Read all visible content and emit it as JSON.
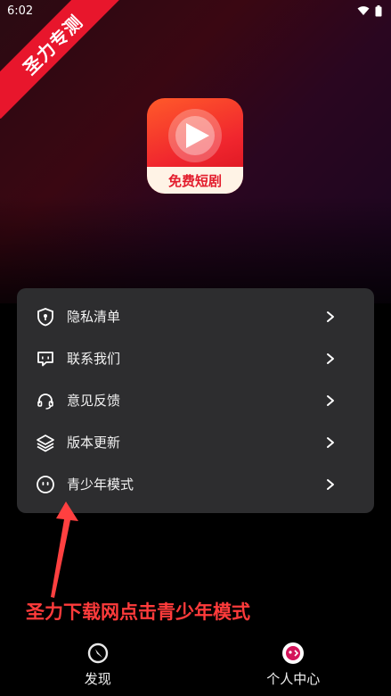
{
  "status_bar": {
    "time": "6:02"
  },
  "ribbon": {
    "text": "圣力专测"
  },
  "app_logo": {
    "banner_text": "免费短剧"
  },
  "menu": {
    "items": [
      {
        "label": "隐私清单",
        "icon": "shield-icon"
      },
      {
        "label": "联系我们",
        "icon": "message-icon"
      },
      {
        "label": "意见反馈",
        "icon": "headset-icon"
      },
      {
        "label": "版本更新",
        "icon": "layers-icon"
      },
      {
        "label": "青少年模式",
        "icon": "face-icon"
      }
    ]
  },
  "annotation": {
    "text": "圣力下载网点击青少年模式",
    "color": "#ff3b3b"
  },
  "bottom_nav": {
    "items": [
      {
        "label": "发现",
        "icon": "discover-icon"
      },
      {
        "label": "个人中心",
        "icon": "profile-icon"
      }
    ]
  },
  "colors": {
    "accent": "#e8162c",
    "card_bg": "#2d2d2f",
    "profile_icon": "#d4145a"
  }
}
